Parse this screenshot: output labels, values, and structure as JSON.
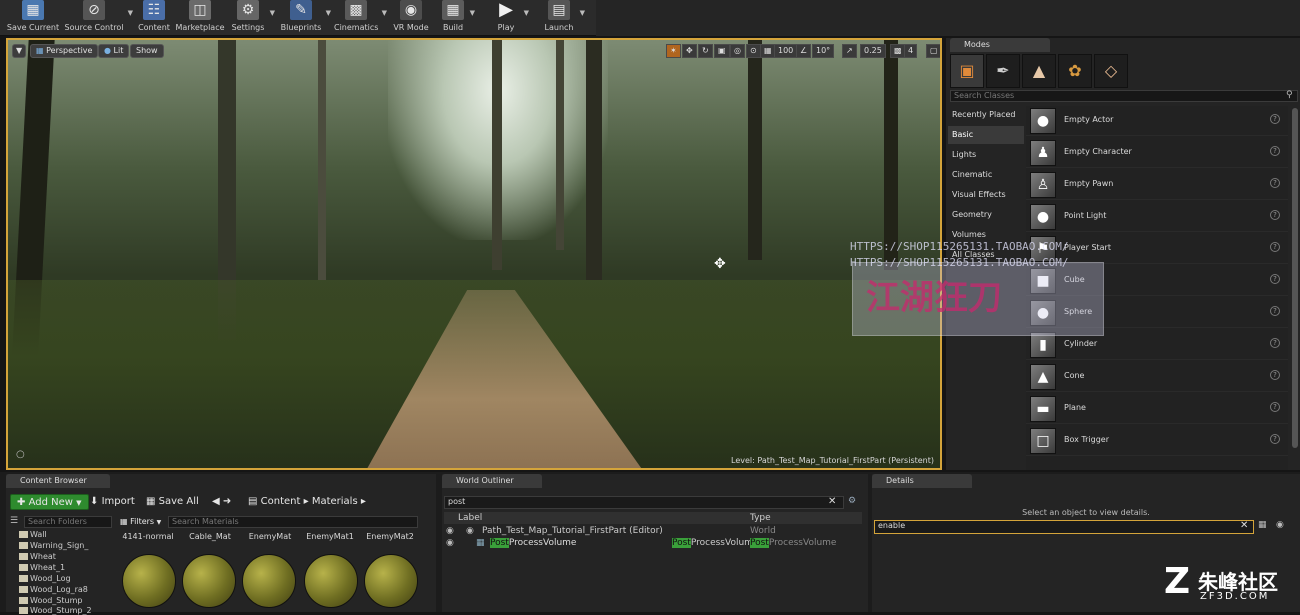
{
  "toolbar": {
    "buttons": [
      {
        "label": "Save Current",
        "icon": "save-icon"
      },
      {
        "label": "Source Control",
        "icon": "source-control-icon"
      },
      {
        "label": "Content",
        "icon": "content-icon"
      },
      {
        "label": "Marketplace",
        "icon": "marketplace-icon"
      },
      {
        "label": "Settings",
        "icon": "settings-icon"
      },
      {
        "label": "Blueprints",
        "icon": "blueprints-icon"
      },
      {
        "label": "Cinematics",
        "icon": "cinematics-icon"
      },
      {
        "label": "VR Mode",
        "icon": "vr-icon"
      },
      {
        "label": "Build",
        "icon": "build-icon"
      },
      {
        "label": "Play",
        "icon": "play-icon"
      },
      {
        "label": "Launch",
        "icon": "launch-icon"
      }
    ]
  },
  "viewport": {
    "perspective": "Perspective",
    "lit": "Lit",
    "show": "Show",
    "grid_snap": "100",
    "rot_snap": "10°",
    "scale_snap": "0.25",
    "camera_speed": "4",
    "level_text": "Level:  Path_Test_Map_Tutorial_FirstPart (Persistent)"
  },
  "modes": {
    "tab": "Modes",
    "search_placeholder": "Search Classes",
    "categories": [
      "Recently Placed",
      "Basic",
      "Lights",
      "Cinematic",
      "Visual Effects",
      "Geometry",
      "Volumes",
      "All Classes"
    ],
    "active_category": "Basic",
    "actors": [
      "Empty Actor",
      "Empty Character",
      "Empty Pawn",
      "Point Light",
      "Player Start",
      "Cube",
      "Sphere",
      "Cylinder",
      "Cone",
      "Plane",
      "Box Trigger"
    ]
  },
  "watermark": {
    "line1": "HTTPS://SHOP115265131.TAOBAO.COM/",
    "line2": "HTTPS://SHOP115265131.TAOBAO.COM/",
    "red": "江湖狂刀",
    "logo_cn": "朱峰社区",
    "logo_en": "ZF3D.COM"
  },
  "content_browser": {
    "tab": "Content Browser",
    "add_new": "Add New",
    "import": "Import",
    "save_all": "Save All",
    "path": [
      "Content",
      "Materials"
    ],
    "search_folders_placeholder": "Search Folders",
    "filters": "Filters",
    "search_materials_placeholder": "Search Materials",
    "folders": [
      "Wall",
      "Warning_Sign_",
      "Wheat",
      "Wheat_1",
      "Wood_Log",
      "Wood_Log_ra8",
      "Wood_Stump",
      "Wood_Stump_2"
    ],
    "assets": [
      "4141-normal",
      "Cable_Mat",
      "EnemyMat",
      "EnemyMat1",
      "EnemyMat2"
    ]
  },
  "world_outliner": {
    "tab": "World Outliner",
    "search_value": "post",
    "col_label": "Label",
    "col_type": "Type",
    "rows": [
      {
        "label": "Path_Test_Map_Tutorial_FirstPart (Editor)",
        "type": "World"
      },
      {
        "label_hl": "Post",
        "label_rest": "ProcessVolume",
        "type_hl": "Post",
        "type_rest": "ProcessVolume",
        "type_hl2": "Post",
        "type_rest2": "ProcessVolume"
      }
    ]
  },
  "details": {
    "tab": "Details",
    "hint": "Select an object to view details.",
    "search_value": "enable"
  }
}
